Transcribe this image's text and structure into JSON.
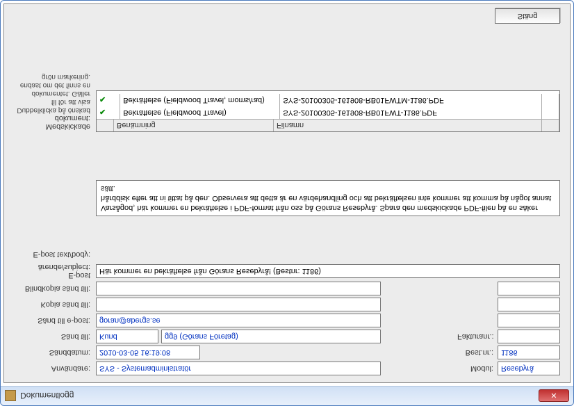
{
  "window": {
    "title": "Dokumentlogg",
    "close": "✕"
  },
  "labels": {
    "anvandare": "Användare:",
    "sanddatum": "Sänddatum:",
    "sand_till": "Sänd till:",
    "sand_till_epost": "Sänd till e-post:",
    "kopia": "Kopia sänd till:",
    "blindkopia": "Blindkopia sänd till:",
    "subject": "E-post ärende/subject:",
    "body": "E-post text/body:",
    "medskickade": "Medskickade dokument:",
    "modul": "Modul:",
    "bestnr": "Best.nr.:",
    "fakturanr": "Fakturanr.:"
  },
  "fields": {
    "anvandare": "SYS - Systemadministratör",
    "sanddatum": "2010-03-05 16:19:08",
    "sand_till_a": "Kund",
    "sand_till_b": "gg9  (Görans Företag)",
    "sand_till_epost": "goran@abergs.se",
    "kopia": "",
    "blindkopia": "",
    "subject": "Här kommer en bekräftelse från Görans Resebyrå! (Bestnr: 1186)",
    "body": "Varsågod, här kommer en bekräftelse i PDF-format från oss på Görans Resebyrå. Spara den medskickade PDF-filen på en säker hårddisk efter att ni tittat på den. Observera att detta är en värdehandling och att bekräftelsen inte kommer att komma på något annat sätt.",
    "modul": "Resebyrå",
    "bestnr": "1186",
    "fakturanr": ""
  },
  "attachments": {
    "headers": {
      "name": "Benämning",
      "file": "Filnamn"
    },
    "rows": [
      {
        "name": "Bekräftelse (Fieldwood Travel)",
        "file": "SYS-20100305-161908-RB01FWT-1186.PDF"
      },
      {
        "name": "Bekräftelse (Fieldwood Travel, moms/rad)",
        "file": "SYS-20100305-161908-RB01FWTM-1186.PDF"
      }
    ]
  },
  "help": "Dubbelklicka på önskad fil för att visa dokumentet. Gäller endast om det finns en grön markering.",
  "buttons": {
    "close": "Stäng"
  }
}
